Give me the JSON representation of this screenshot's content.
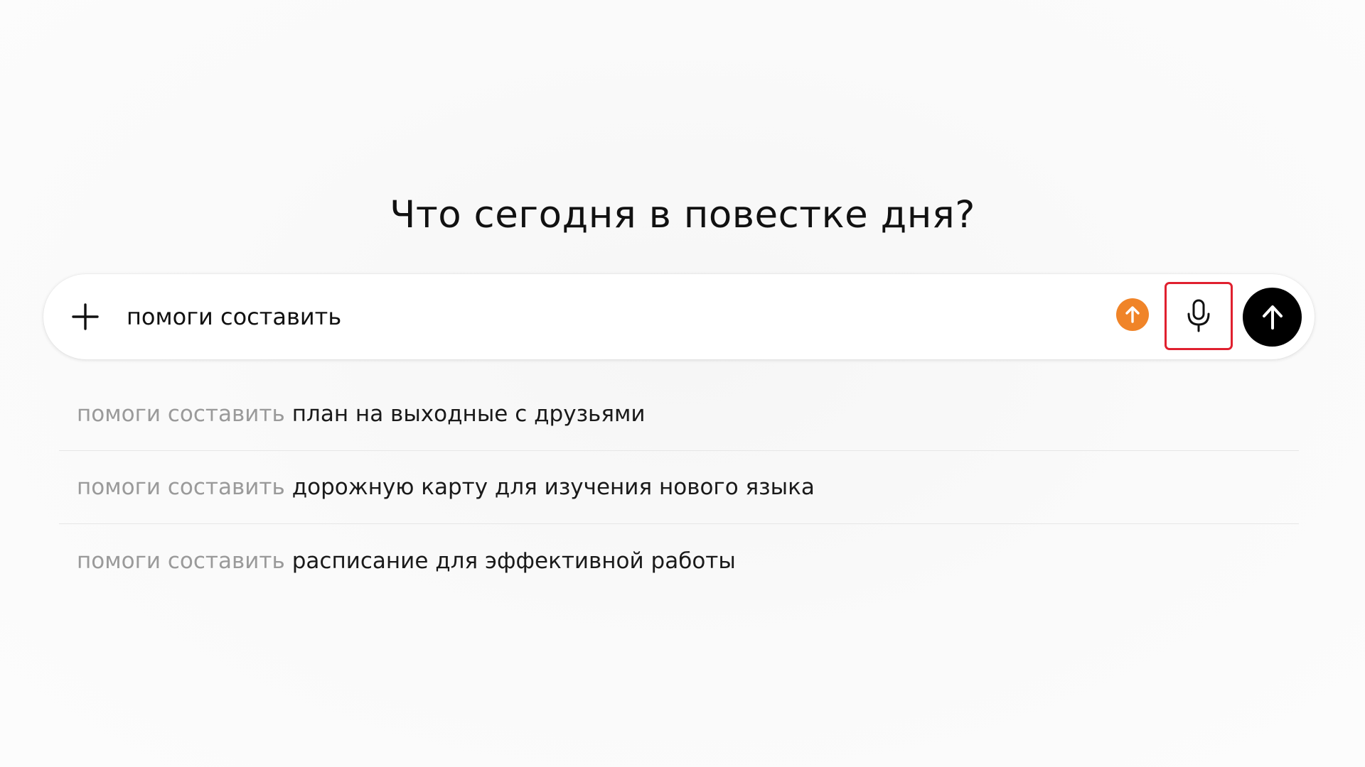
{
  "header": {
    "title": "Что сегодня в повестке дня?"
  },
  "composer": {
    "input_value": "помоги составить",
    "add_icon": "plus-icon",
    "upgrade_icon": "arrow-up-circle-icon",
    "mic_icon": "microphone-icon",
    "send_icon": "arrow-up-icon",
    "accent_color": "#f08428",
    "highlight_color": "#e0202f"
  },
  "suggestions": [
    {
      "prefix": "помоги составить",
      "rest": "план на выходные с друзьями"
    },
    {
      "prefix": "помоги составить",
      "rest": "дорожную карту для изучения нового языка"
    },
    {
      "prefix": "помоги составить",
      "rest": "расписание для эффективной работы"
    }
  ]
}
